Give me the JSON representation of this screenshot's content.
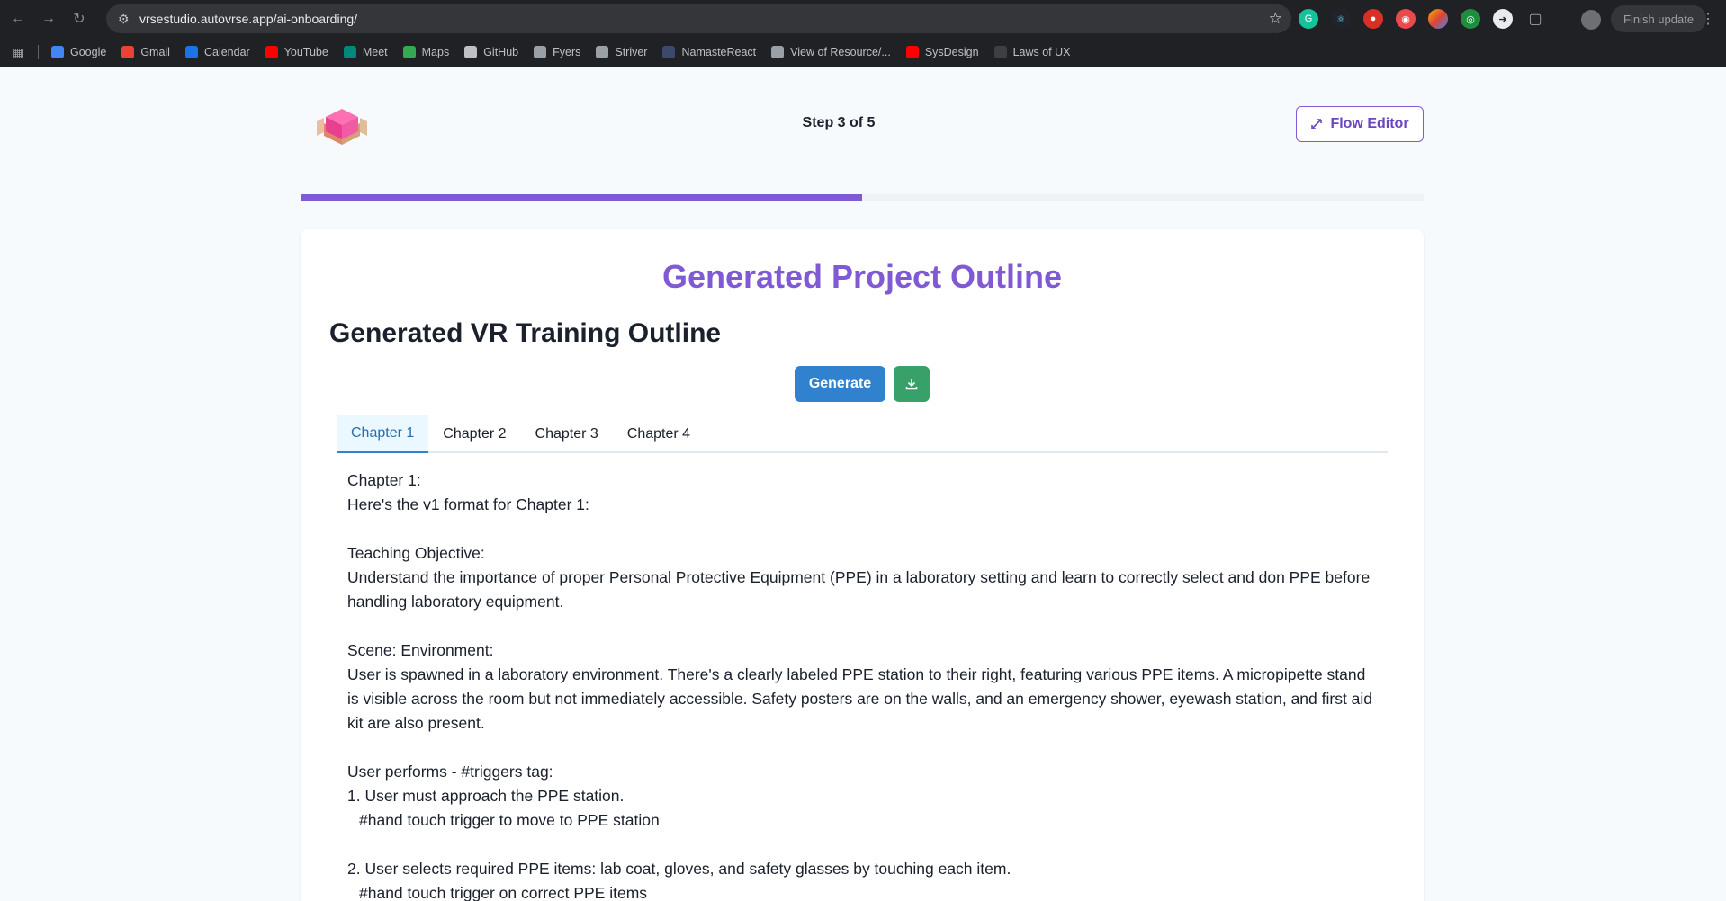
{
  "browser": {
    "url": "vrsestudio.autovrse.app/ai-onboarding/",
    "finish_update": "Finish update",
    "bookmarks": [
      {
        "label": "Google",
        "color": "#4285f4"
      },
      {
        "label": "Gmail",
        "color": "#ea4335"
      },
      {
        "label": "Calendar",
        "color": "#1a73e8"
      },
      {
        "label": "YouTube",
        "color": "#ff0000"
      },
      {
        "label": "Meet",
        "color": "#00897b"
      },
      {
        "label": "Maps",
        "color": "#34a853"
      },
      {
        "label": "GitHub",
        "color": "#bdc1c6"
      },
      {
        "label": "Fyers",
        "color": "#9aa0a6"
      },
      {
        "label": "Striver",
        "color": "#9aa0a6"
      },
      {
        "label": "NamasteReact",
        "color": "#3b4a6b"
      },
      {
        "label": "View of Resource/...",
        "color": "#9aa0a6"
      },
      {
        "label": "SysDesign",
        "color": "#ff0000"
      },
      {
        "label": "Laws of UX",
        "color": "#3c4043"
      }
    ]
  },
  "header": {
    "step": "Step 3 of 5",
    "flow_editor": "Flow Editor",
    "progress_fraction": 0.5
  },
  "main": {
    "title": "Generated Project Outline",
    "outline_title": "Generated VR Training Outline",
    "generate_label": "Generate",
    "tabs": [
      {
        "label": "Chapter 1",
        "active": true
      },
      {
        "label": "Chapter 2",
        "active": false
      },
      {
        "label": "Chapter 3",
        "active": false
      },
      {
        "label": "Chapter 4",
        "active": false
      }
    ],
    "content": {
      "chapter_heading": "Chapter 1:",
      "intro": "Here's the v1 format for Chapter 1:",
      "objective_label": "Teaching Objective:",
      "objective_text": "Understand the importance of proper Personal Protective Equipment (PPE) in a laboratory setting and learn to correctly select and don PPE before handling laboratory equipment.",
      "scene_label": "Scene: Environment:",
      "scene_text": "User is spawned in a laboratory environment. There's a clearly labeled PPE station to their right, featuring various PPE items. A micropipette stand is visible across the room but not immediately accessible. Safety posters are on the walls, and an emergency shower, eyewash station, and first aid kit are also present.",
      "triggers_label": "User performs - #triggers tag:",
      "step1": "1. User must approach the PPE station.",
      "step1_trigger": "#hand touch trigger to move to PPE station",
      "step2": "2. User selects required PPE items: lab coat, gloves, and safety glasses by touching each item.",
      "step2_trigger": "#hand touch trigger on correct PPE items"
    }
  }
}
